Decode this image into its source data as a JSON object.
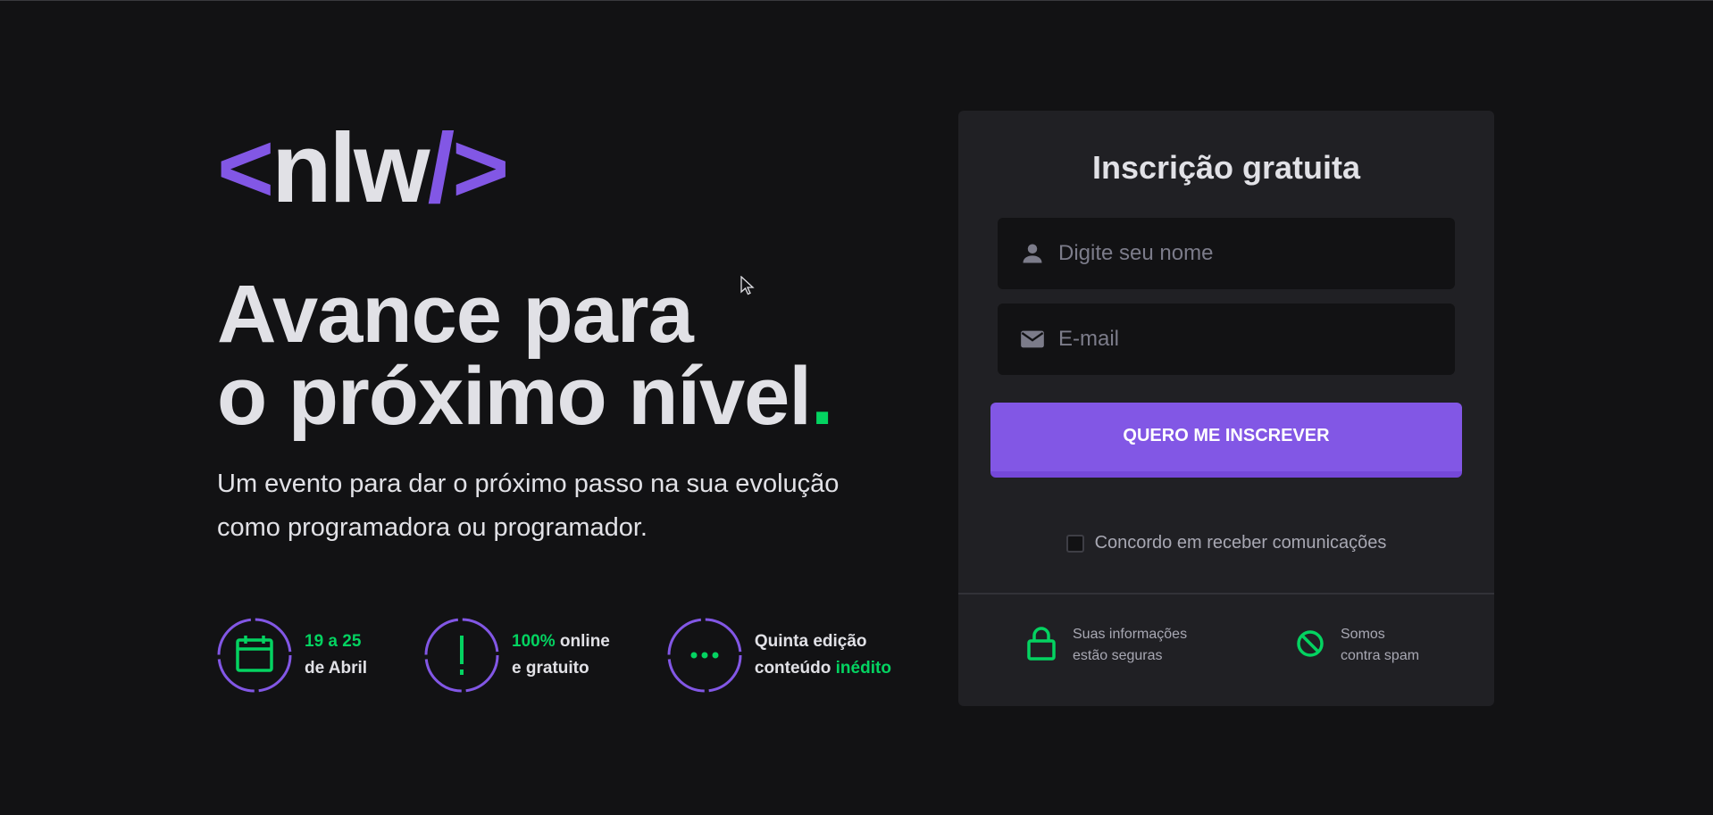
{
  "brand": {
    "logo_open": "<",
    "logo_text": "nlw",
    "logo_slash": "/",
    "logo_close": ">"
  },
  "hero": {
    "title_line1": "Avance para",
    "title_line2": "o próximo nível",
    "title_dot": ".",
    "subtitle": "Um evento para dar o próximo passo na sua evolução como programadora ou programador."
  },
  "features": [
    {
      "icon": "calendar-icon",
      "line1_accent": "19 a 25",
      "line2": "de Abril"
    },
    {
      "icon": "exclamation-icon",
      "line1_accent": "100%",
      "line1_rest": " online",
      "line2": "e gratuito"
    },
    {
      "icon": "ellipsis-icon",
      "line1": "Quinta edição",
      "line2_prefix": "conteúdo ",
      "line2_accent": "inédito"
    }
  ],
  "form": {
    "title": "Inscrição gratuita",
    "name_placeholder": "Digite seu nome",
    "email_placeholder": "E-mail",
    "submit_label": "QUERO ME INSCREVER",
    "consent_label": "Concordo em receber comunicações"
  },
  "footer": {
    "secure_line1": "Suas informações",
    "secure_line2": "estão seguras",
    "spam_line1": "Somos",
    "spam_line2": "contra spam"
  },
  "colors": {
    "background": "#121214",
    "card": "#202024",
    "accent_purple": "#8257e5",
    "accent_green": "#04d361",
    "text": "#e1e1e6"
  }
}
